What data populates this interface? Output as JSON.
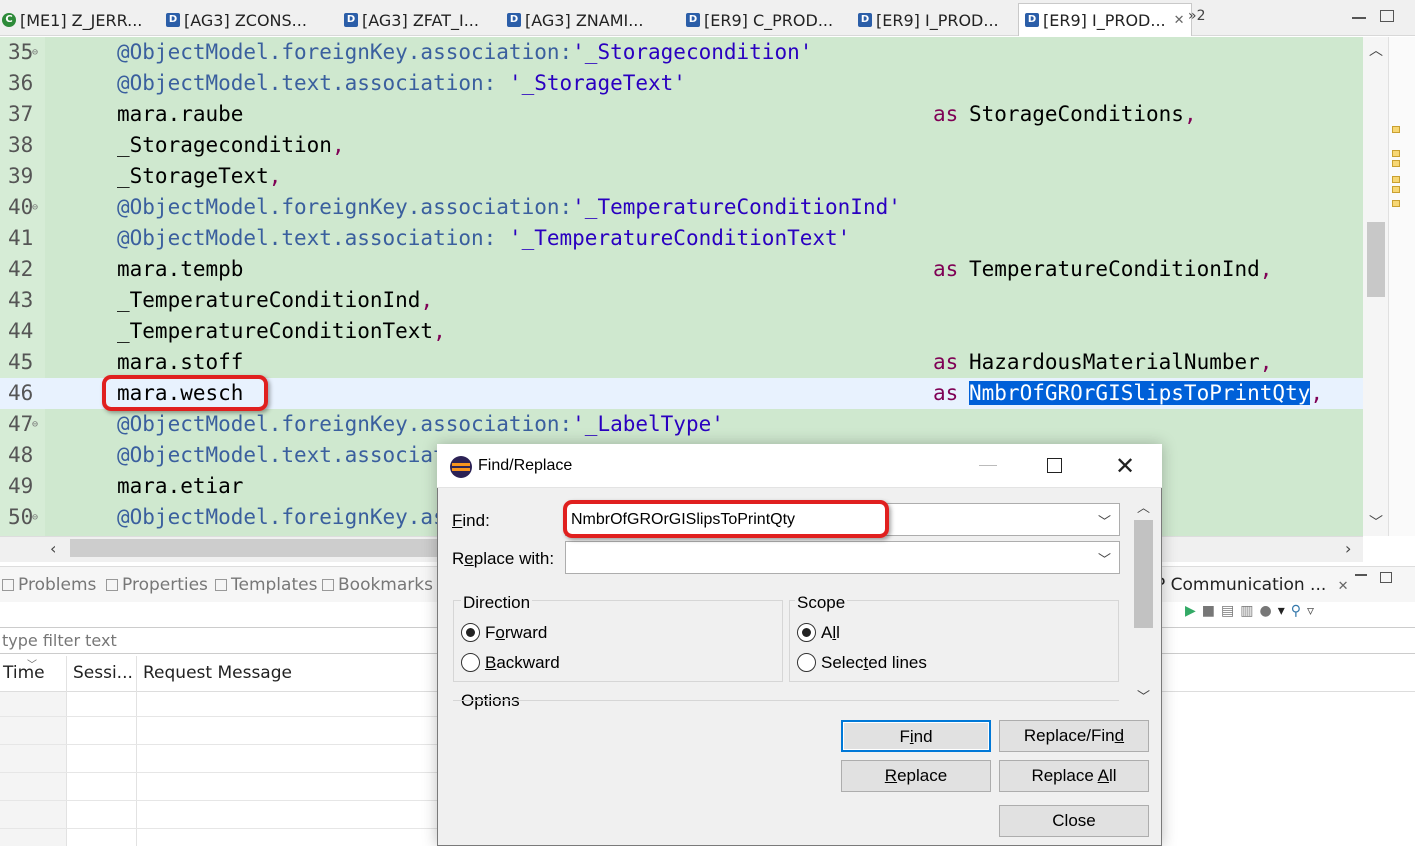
{
  "tabs": [
    {
      "label": "[ME1] Z_JERR...",
      "icon": "cds-view-icon"
    },
    {
      "label": "[AG3] ZCONS...",
      "icon": "ddl-source-icon"
    },
    {
      "label": "[AG3] ZFAT_I...",
      "icon": "ddl-source-icon"
    },
    {
      "label": "[AG3] ZNAMI...",
      "icon": "ddl-source-icon"
    },
    {
      "label": "[ER9] C_PROD...",
      "icon": "ddl-source-icon"
    },
    {
      "label": "[ER9] I_PROD...",
      "icon": "ddl-source-icon"
    },
    {
      "label": "[ER9] I_PROD...",
      "icon": "ddl-source-icon",
      "active": true
    }
  ],
  "tab_overflow": "»2",
  "editor": {
    "lines": [
      {
        "n": "35",
        "fold": true,
        "text": "@ObjectModel.foreignKey.association:'_Storagecondition'",
        "type": "annotation"
      },
      {
        "n": "36",
        "fold": false,
        "text": "@ObjectModel.text.association: '_StorageText'",
        "type": "annotation"
      },
      {
        "n": "37",
        "fold": false,
        "text": "mara.raube",
        "kw": "as",
        "alias": "StorageConditions",
        "tail": ","
      },
      {
        "n": "38",
        "fold": false,
        "text": "_Storagecondition",
        "tail": ","
      },
      {
        "n": "39",
        "fold": false,
        "text": "_StorageText",
        "tail": ","
      },
      {
        "n": "40",
        "fold": true,
        "text": "@ObjectModel.foreignKey.association:'_TemperatureConditionInd'",
        "type": "annotation"
      },
      {
        "n": "41",
        "fold": false,
        "text": "@ObjectModel.text.association: '_TemperatureConditionText'",
        "type": "annotation"
      },
      {
        "n": "42",
        "fold": false,
        "text": "mara.tempb",
        "kw": "as",
        "alias": "TemperatureConditionInd",
        "tail": ","
      },
      {
        "n": "43",
        "fold": false,
        "text": "_TemperatureConditionInd",
        "tail": ","
      },
      {
        "n": "44",
        "fold": false,
        "text": "_TemperatureConditionText",
        "tail": ","
      },
      {
        "n": "45",
        "fold": false,
        "text": "mara.stoff",
        "kw": "as",
        "alias": "HazardousMaterialNumber",
        "tail": ","
      },
      {
        "n": "46",
        "fold": false,
        "text": "mara.wesch",
        "kw": "as",
        "alias": "NmbrOfGROrGISlipsToPrintQty",
        "tail": ",",
        "current": true,
        "selected_alias": true
      },
      {
        "n": "47",
        "fold": true,
        "text": "@ObjectModel.foreignKey.association:'_LabelType'",
        "type": "annotation"
      },
      {
        "n": "48",
        "fold": false,
        "text": "@ObjectModel.text.associati",
        "type": "annotation"
      },
      {
        "n": "49",
        "fold": false,
        "text": "mara.etiar"
      },
      {
        "n": "50",
        "fold": true,
        "text": "@ObjectModel.foreignKey.ass",
        "type": "annotation"
      }
    ]
  },
  "bottom_panel": {
    "view_tabs": [
      "Problems",
      "Properties",
      "Templates",
      "Bookmarks"
    ],
    "active_view_tab": "P Communication ...",
    "filter_placeholder": "type filter text",
    "columns": [
      "Time",
      "Sessi...",
      "Request Message"
    ]
  },
  "dialog": {
    "title": "Find/Replace",
    "find_label": "Find:",
    "find_value": "NmbrOfGROrGISlipsToPrintQty",
    "replace_label": "Replace with:",
    "replace_value": "",
    "direction_label": "Direction",
    "forward_label": "Forward",
    "backward_label": "Backward",
    "direction_selected": "Forward",
    "scope_label": "Scope",
    "all_label": "All",
    "selected_lines_label": "Selected lines",
    "scope_selected": "All",
    "options_label": "Options",
    "buttons": {
      "find": "Find",
      "replace_find": "Replace/Find",
      "replace": "Replace",
      "replace_all": "Replace All",
      "close": "Close"
    }
  }
}
